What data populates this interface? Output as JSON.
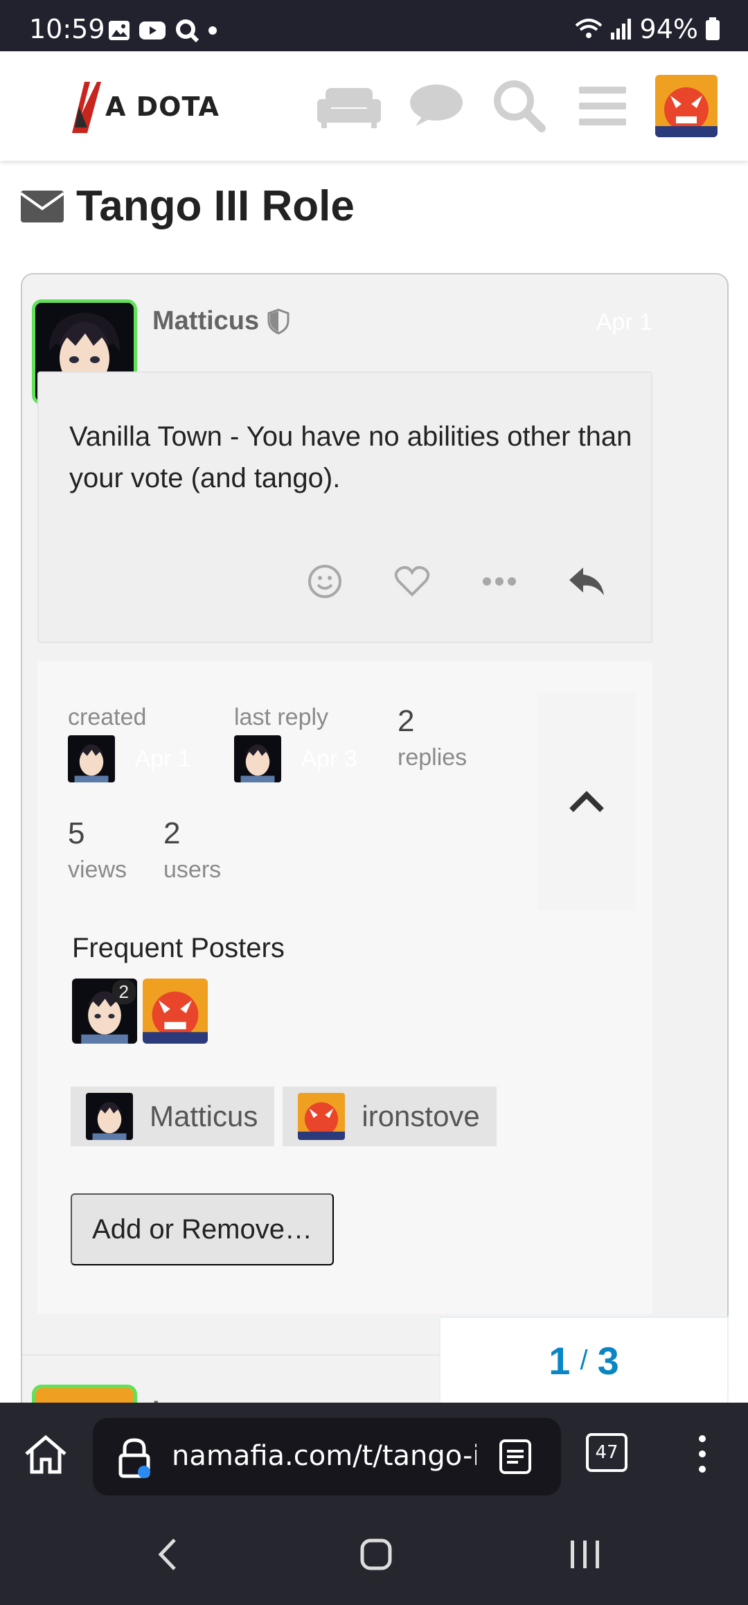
{
  "status_bar": {
    "time": "10:59",
    "battery": "94%"
  },
  "header": {
    "logo_text": "A DOTA",
    "icons": [
      "couch-icon",
      "chat-icon",
      "search-icon",
      "hamburger-menu-icon"
    ]
  },
  "topic": {
    "title": "Tango III Role"
  },
  "post": {
    "username": "Matticus",
    "date": "Apr 1",
    "body": "Vanilla Town - You have no abilities other than your vote (and tango)."
  },
  "summary": {
    "created_label": "created",
    "created_date": "Apr 1",
    "last_reply_label": "last reply",
    "last_reply_date": "Apr 3",
    "replies_count": "2",
    "replies_label": "replies",
    "views_count": "5",
    "views_label": "views",
    "users_count": "2",
    "users_label": "users",
    "frequent_posters_title": "Frequent Posters",
    "poster_badge": "2",
    "participants": [
      "Matticus",
      "ironstove"
    ],
    "add_remove_label": "Add or Remove…"
  },
  "next_post": {
    "username": "ironstove"
  },
  "progress": {
    "current": "1",
    "separator": "/",
    "total": "3"
  },
  "browser": {
    "url": "namafia.com/t/tango-i",
    "tab_count": "47"
  },
  "colors": {
    "accent": "#0a86c4",
    "avatar_border": "#63e05a",
    "status_bar_bg": "#22222e"
  }
}
